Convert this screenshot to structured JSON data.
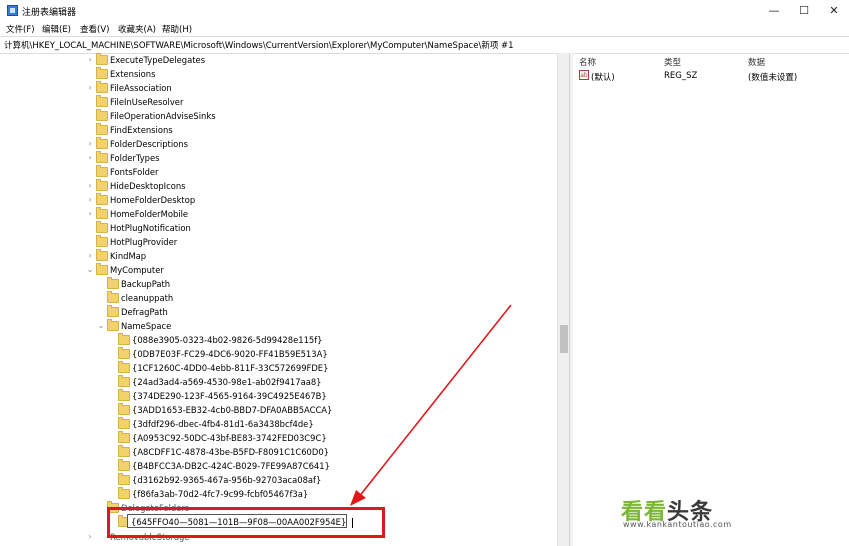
{
  "window": {
    "title": "注册表编辑器",
    "minimize": "—",
    "maximize": "☐",
    "close": "✕"
  },
  "menus": [
    "文件(F)",
    "编辑(E)",
    "查看(V)",
    "收藏夹(A)",
    "帮助(H)"
  ],
  "address": "计算机\\HKEY_LOCAL_MACHINE\\SOFTWARE\\Microsoft\\Windows\\CurrentVersion\\Explorer\\MyComputer\\NameSpace\\新项 #1",
  "tree": {
    "level1": [
      "ExecuteTypeDelegates",
      "Extensions",
      "FileAssociation",
      "FileInUseResolver",
      "FileOperationAdviseSinks",
      "FindExtensions",
      "FolderDescriptions",
      "FolderTypes",
      "FontsFolder",
      "HideDesktopIcons",
      "HomeFolderDesktop",
      "HomeFolderMobile",
      "HotPlugNotification",
      "HotPlugProvider",
      "KindMap",
      "MyComputer"
    ],
    "level2": [
      "BackupPath",
      "cleanuppath",
      "DefragPath",
      "NameSpace"
    ],
    "level3": [
      "{088e3905-0323-4b02-9826-5d99428e115f}",
      "{0DB7E03F-FC29-4DC6-9020-FF41B59E513A}",
      "{1CF1260C-4DD0-4ebb-811F-33C572699FDE}",
      "{24ad3ad4-a569-4530-98e1-ab02f9417aa8}",
      "{374DE290-123F-4565-9164-39C4925E467B}",
      "{3ADD1653-EB32-4cb0-BBD7-DFA0ABB5ACCA}",
      "{3dfdf296-dbec-4fb4-81d1-6a3438bcf4de}",
      "{A0953C92-50DC-43bf-BE83-3742FED03C9C}",
      "{A8CDFF1C-4878-43be-B5FD-F8091C1C60D0}",
      "{B4BFCC3A-DB2C-424C-B029-7FE99A87C641}",
      "{d3162b92-9365-467a-956b-92703aca08af}",
      "{f86fa3ab-70d2-4fc7-9c99-fcbf05467f3a}"
    ],
    "partial_after": "DelegateFolders",
    "partial_bottom": "RemovableStorage",
    "editing_value": "{645FFO40—5081—101B—9F08—00AA002F954E}"
  },
  "right_pane": {
    "headers": [
      "名称",
      "类型",
      "数据"
    ],
    "row": {
      "name": "(默认)",
      "type": "REG_SZ",
      "data": "(数值未设置)",
      "icon": "ab"
    }
  },
  "watermark": {
    "part1": "看看",
    "part2": "头条",
    "url": "www.kankantoutiao.com"
  },
  "colors": {
    "highlight": "#e0181b",
    "folder": "#f2d36b",
    "watermark_green": "#7cb733"
  }
}
